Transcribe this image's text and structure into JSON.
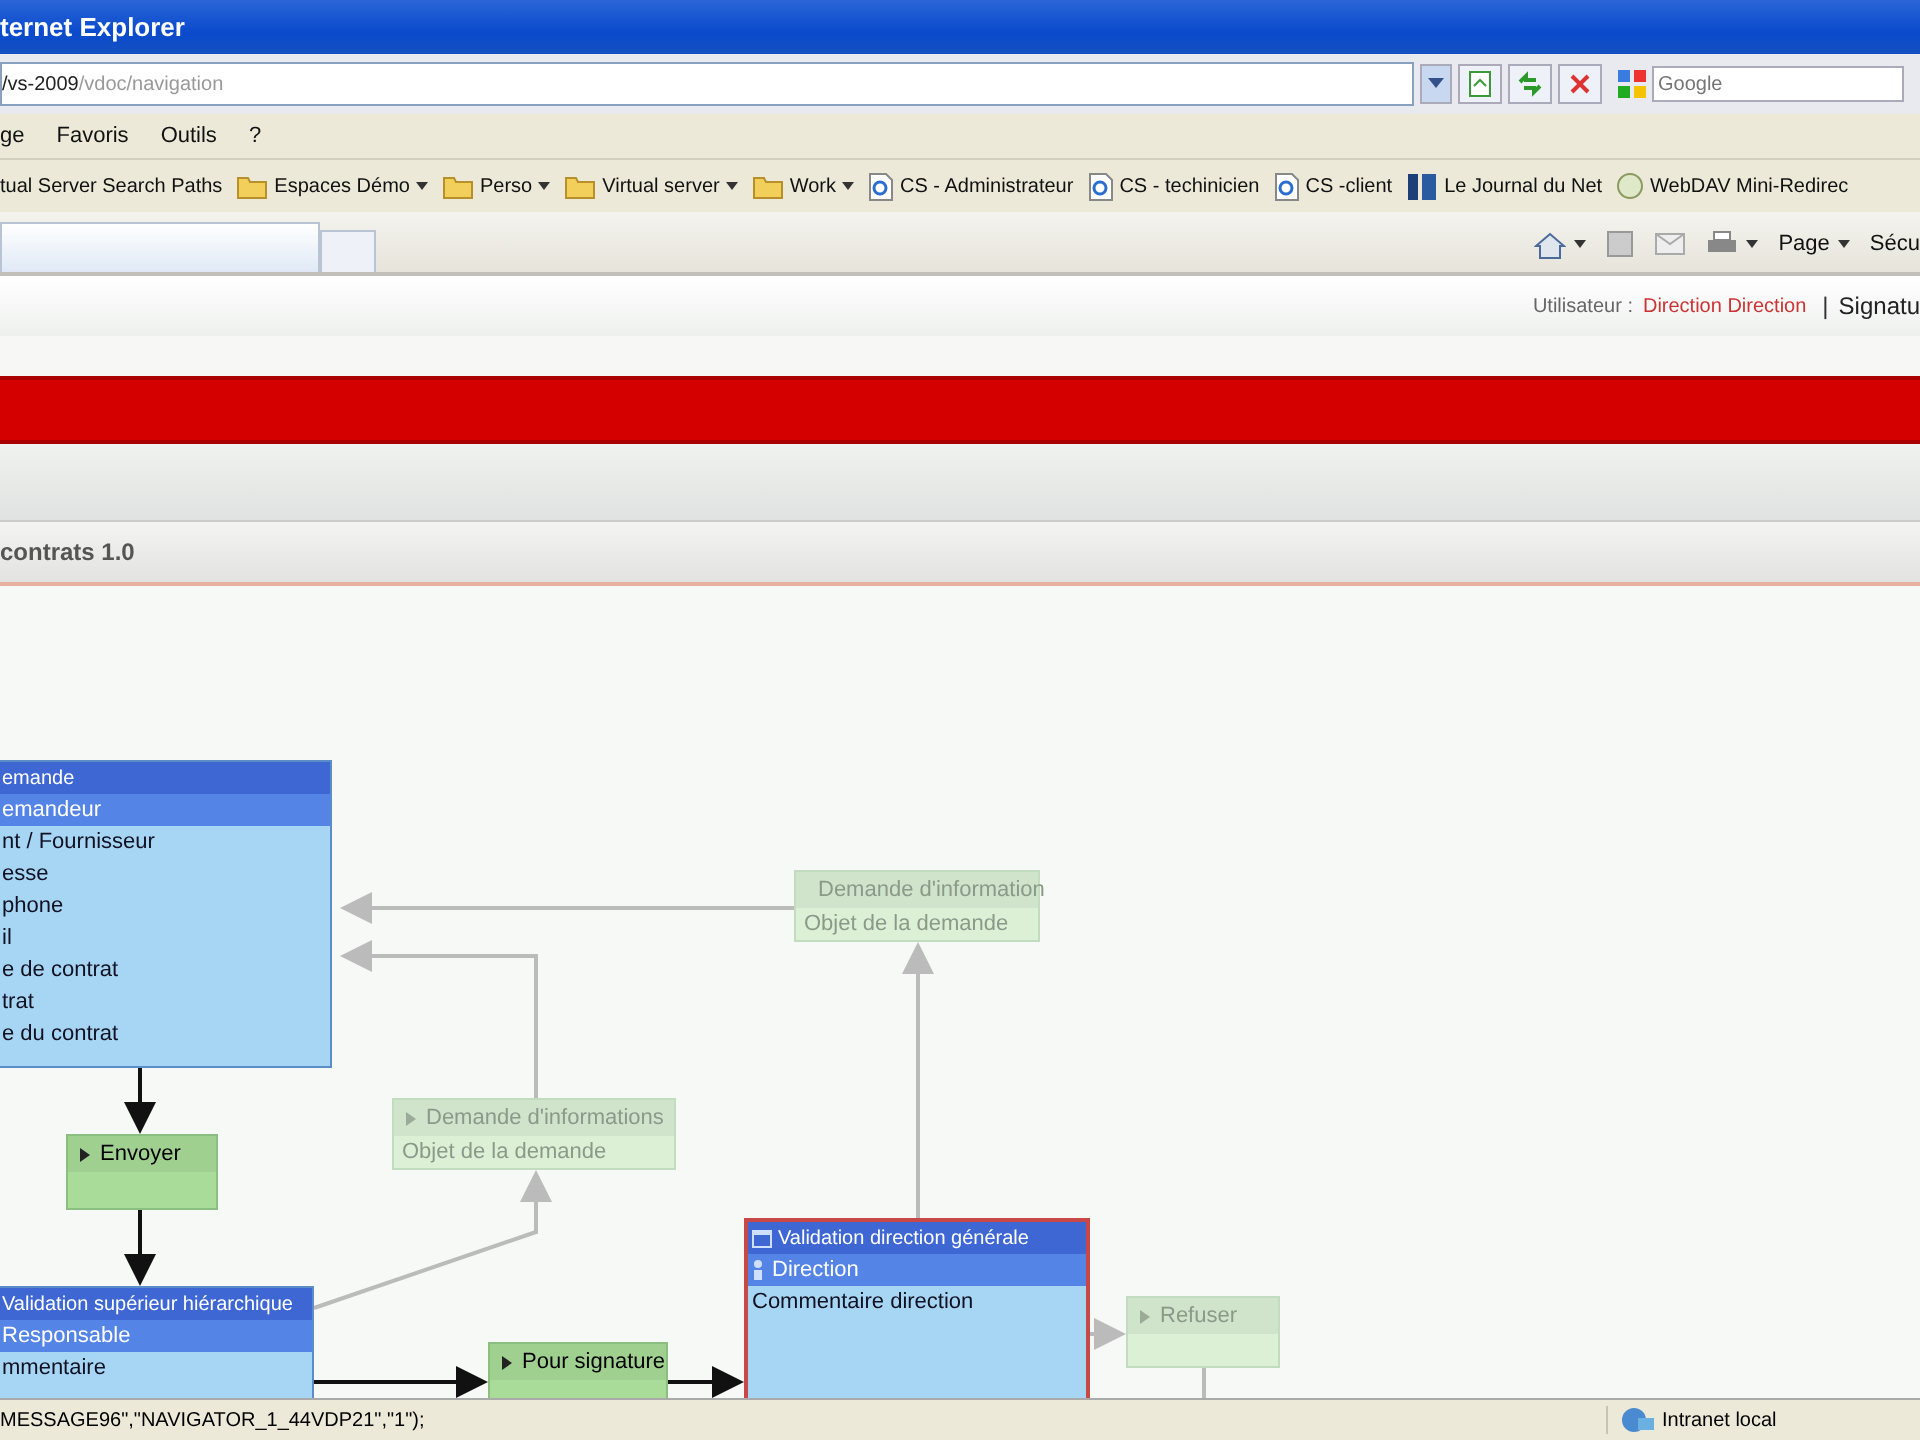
{
  "window": {
    "title": "ternet Explorer"
  },
  "address_bar": {
    "host": "/vs-2009",
    "path": "/vdoc/navigation",
    "search_placeholder": "Google"
  },
  "menu": [
    "ge",
    "Favoris",
    "Outils",
    "?"
  ],
  "bookmarks": [
    {
      "kind": "plain",
      "label": "tual Server Search Paths",
      "has_menu": false
    },
    {
      "kind": "folder",
      "label": "Espaces Démo",
      "has_menu": true
    },
    {
      "kind": "folder",
      "label": "Perso",
      "has_menu": true
    },
    {
      "kind": "folder",
      "label": "Virtual server",
      "has_menu": true
    },
    {
      "kind": "folder",
      "label": "Work",
      "has_menu": true
    },
    {
      "kind": "page",
      "label": "CS - Administrateur",
      "has_menu": false
    },
    {
      "kind": "page",
      "label": "CS - techinicien",
      "has_menu": false
    },
    {
      "kind": "page",
      "label": "CS -client",
      "has_menu": false
    },
    {
      "kind": "journal",
      "label": "Le Journal du Net",
      "has_menu": false
    },
    {
      "kind": "webdav",
      "label": "WebDAV Mini-Redirec",
      "has_menu": false
    }
  ],
  "command_bar": {
    "page": "Page",
    "security": "Sécu"
  },
  "user_bar": {
    "label": "Utilisateur :",
    "user": "Direction Direction",
    "separator": "|",
    "link": "Signatu"
  },
  "page_title": "contrats 1.0",
  "diagram": {
    "nodes": [
      {
        "kind": "task",
        "header": "emande",
        "role": "emandeur",
        "fields": [
          "nt / Fournisseur",
          "esse",
          "phone",
          "il",
          "e de contrat",
          "trat",
          "e du contrat"
        ],
        "selected": false,
        "icons": false
      },
      {
        "kind": "faded",
        "label": "Demande d'information",
        "field": "Objet de la demande"
      },
      {
        "kind": "action",
        "label": "Envoyer"
      },
      {
        "kind": "faded",
        "label": "Demande d'informations",
        "field": "Objet de la demande"
      },
      {
        "kind": "task",
        "header": "Validation direction générale",
        "role": "Direction",
        "fields": [
          "Commentaire direction"
        ],
        "selected": true,
        "icons": true
      },
      {
        "kind": "task",
        "header": "Validation supérieur hiérarchique",
        "role": "Responsable",
        "fields": [
          "mmentaire"
        ],
        "selected": false,
        "icons": false
      },
      {
        "kind": "faded",
        "label": "Refuser"
      },
      {
        "kind": "action",
        "label": "Pour signature"
      }
    ]
  },
  "status_bar": {
    "text": "MESSAGE96\",\"NAVIGATOR_1_44VDP21\",\"1\");",
    "zone": "Intranet local"
  }
}
